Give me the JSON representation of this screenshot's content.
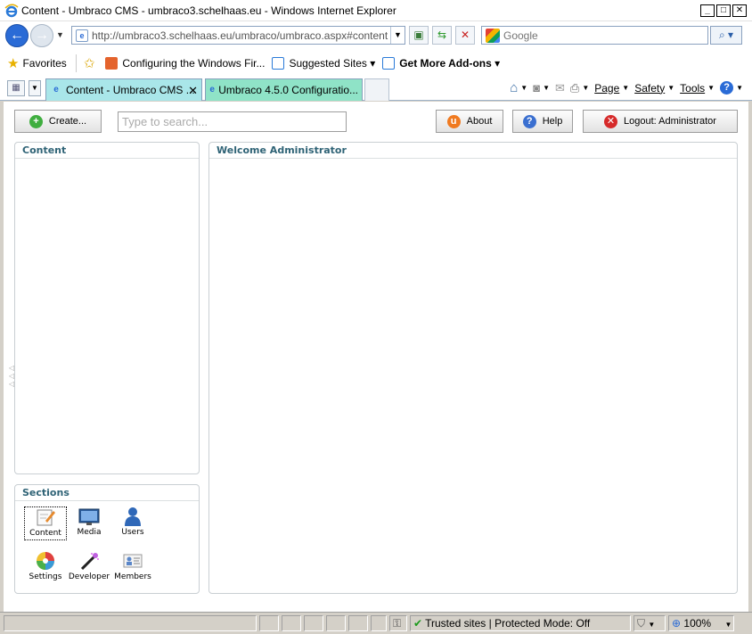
{
  "window": {
    "title": "Content - Umbraco CMS - umbraco3.schelhaas.eu - Windows Internet Explorer",
    "minimize": "_",
    "maximize": "□",
    "close": "✕"
  },
  "address": {
    "url": "http://umbraco3.schelhaas.eu/umbraco/umbraco.aspx#content",
    "search_placeholder": "Google"
  },
  "favorites": {
    "label": "Favorites",
    "items": [
      {
        "label": "Configuring the Windows Fir..."
      },
      {
        "label": "Suggested Sites ▾"
      },
      {
        "label": "Get More Add-ons ▾"
      }
    ]
  },
  "tabs": [
    {
      "label": "Content - Umbraco CMS ...",
      "active": true
    },
    {
      "label": "Umbraco 4.5.0 Configuratio...",
      "active": false
    }
  ],
  "command_bar": {
    "page": "Page",
    "safety": "Safety",
    "tools": "Tools",
    "help": "?"
  },
  "umbraco": {
    "create_label": "Create...",
    "search_placeholder": "Type to search...",
    "about_label": "About",
    "help_label": "Help",
    "logout_label": "Logout: Administrator",
    "content_panel_title": "Content",
    "welcome_panel_title": "Welcome Administrator",
    "sections_title": "Sections",
    "sections": [
      {
        "label": "Content",
        "icon": "content-icon",
        "active": true
      },
      {
        "label": "Media",
        "icon": "media-icon"
      },
      {
        "label": "Users",
        "icon": "users-icon"
      },
      {
        "label": "Settings",
        "icon": "settings-icon"
      },
      {
        "label": "Developer",
        "icon": "developer-icon"
      },
      {
        "label": "Members",
        "icon": "members-icon"
      }
    ]
  },
  "status": {
    "zone": "Trusted sites | Protected Mode: Off",
    "zoom": "100%"
  },
  "colors": {
    "active_tab": "#a9e6e9",
    "inactive_tab": "#8fe3c7",
    "panel_heading": "#2f6376"
  }
}
